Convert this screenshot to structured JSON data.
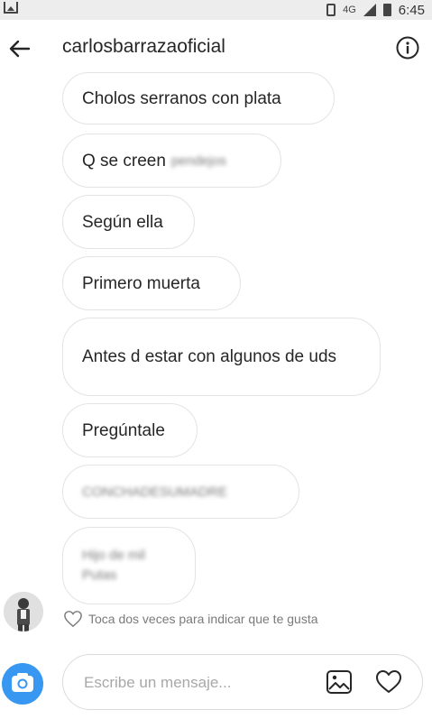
{
  "statusbar": {
    "network": "4G",
    "time": "6:45"
  },
  "header": {
    "username": "carlosbarrazaoficial"
  },
  "messages": [
    {
      "text": "Cholos serranos con plata"
    },
    {
      "text": "Q se creen",
      "blurred_text": "pendejos"
    },
    {
      "text": "Según ella"
    },
    {
      "text": "Primero muerta"
    },
    {
      "text": "Antes d estar con algunos de uds"
    },
    {
      "text": "Pregúntale"
    },
    {
      "text": "",
      "blurred_text": "CONCHADESUMADRE"
    },
    {
      "text": "",
      "blurred_text": "Hijo de mil Putas"
    }
  ],
  "like_hint": "Toca dos veces para indicar que te gusta",
  "composer": {
    "placeholder": "Escribe un mensaje..."
  },
  "colors": {
    "accent": "#3897f0",
    "bubble_border": "#e3e3e3",
    "hint": "#7a7a7a"
  },
  "icons": [
    "back-arrow-icon",
    "info-icon",
    "camera-icon",
    "gallery-icon",
    "heart-icon"
  ]
}
